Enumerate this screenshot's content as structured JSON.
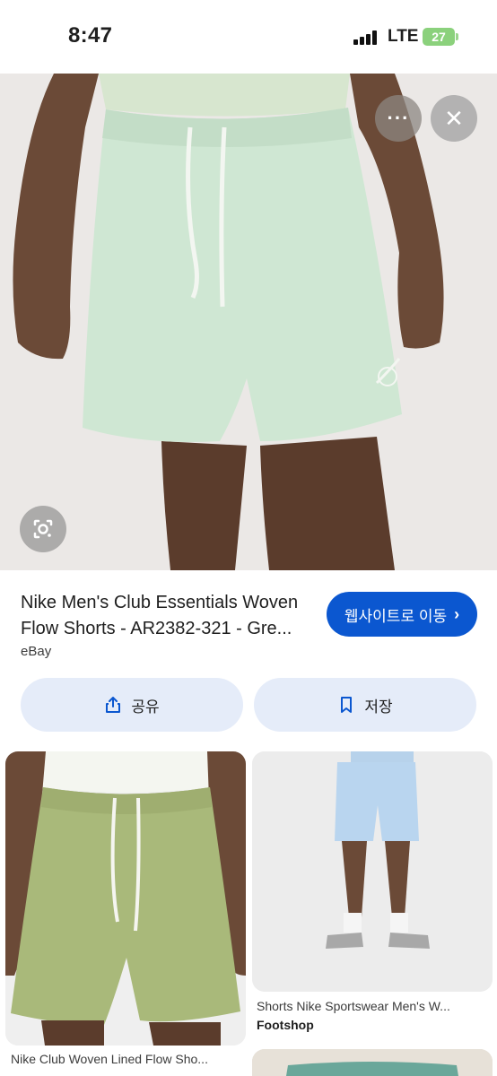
{
  "status_bar": {
    "time": "8:47",
    "network": "LTE",
    "battery": "27"
  },
  "hero": {
    "image_description_icon": "shorts-photo",
    "more_label": "···",
    "close_label": "✕"
  },
  "product": {
    "title_line1": "Nike Men's Club Essentials Woven",
    "title_line2": "Flow Shorts - AR2382-321 - Gre...",
    "source": "eBay",
    "visit_label": "웹사이트로 이동",
    "visit_chevron": "›"
  },
  "actions": {
    "share_label": "공유",
    "save_label": "저장"
  },
  "results": [
    {
      "caption": "Nike Club Woven Lined Flow Sho...",
      "source": ""
    },
    {
      "caption": "Shorts Nike Sportswear Men's W...",
      "source": "Footshop"
    }
  ],
  "colors": {
    "accent": "#0b57d0",
    "action_bg": "#e5ecf9",
    "shorts_mint": "#cfe7d3",
    "shorts_olive": "#a9b97a",
    "shorts_blue": "#b9d5ef"
  }
}
